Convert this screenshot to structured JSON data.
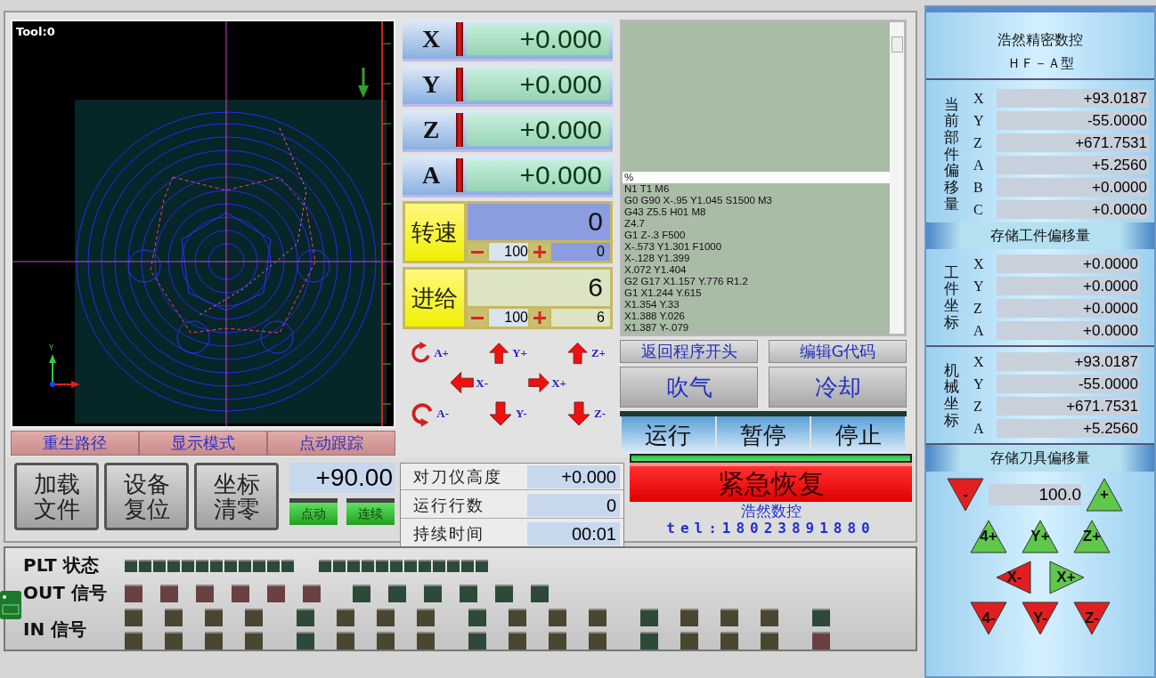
{
  "viewport": {
    "tool_label": "Tool:0",
    "axis_label": "Y"
  },
  "view_buttons": [
    "重生路径",
    "显示模式",
    "点动跟踪"
  ],
  "dro": [
    {
      "axis": "X",
      "value": "+0.000"
    },
    {
      "axis": "Y",
      "value": "+0.000"
    },
    {
      "axis": "Z",
      "value": "+0.000"
    },
    {
      "axis": "A",
      "value": "+0.000"
    }
  ],
  "rates": [
    {
      "label": "转速",
      "value": "0",
      "override": "100",
      "actual": "0",
      "kind": "spindle"
    },
    {
      "label": "进给",
      "value": "6",
      "override": "100",
      "actual": "6",
      "kind": "feed"
    }
  ],
  "jog_pad": [
    {
      "label": "A+",
      "kind": "clockwise"
    },
    {
      "label": "Y+",
      "kind": "up"
    },
    {
      "label": "Z+",
      "kind": "up"
    },
    {
      "label": "X-",
      "kind": "left"
    },
    {
      "label": "X+",
      "kind": "right"
    },
    {
      "label": "A-",
      "kind": "anticlockwise"
    },
    {
      "label": "Y-",
      "kind": "down"
    },
    {
      "label": "Z-",
      "kind": "down"
    }
  ],
  "gcode": {
    "lines": [
      {
        "text": "%",
        "selected": true
      },
      {
        "text": "N1 T1 M6",
        "selected": false
      },
      {
        "text": "G0 G90 X-.95 Y1.045 S1500 M3",
        "selected": false
      },
      {
        "text": "G43 Z5.5 H01 M8",
        "selected": false
      },
      {
        "text": "Z4.7",
        "selected": false
      },
      {
        "text": "G1 Z-.3 F500",
        "selected": false
      },
      {
        "text": "X-.573 Y1.301 F1000",
        "selected": false
      },
      {
        "text": "X-.128 Y1.399",
        "selected": false
      },
      {
        "text": "X.072 Y1.404",
        "selected": false
      },
      {
        "text": "G2 G17 X1.157 Y.776 R1.2",
        "selected": false
      },
      {
        "text": "G1 X1.244 Y.615",
        "selected": false
      },
      {
        "text": "X1.354 Y.33",
        "selected": false
      },
      {
        "text": "X1.388 Y.026",
        "selected": false
      },
      {
        "text": "X1.387 Y-.079",
        "selected": false
      }
    ]
  },
  "program_buttons": [
    "返回程序开头",
    "编辑G代码"
  ],
  "aux_buttons": [
    "吹气",
    "冷却"
  ],
  "run_buttons": [
    "运行",
    "暂停",
    "停止"
  ],
  "file_buttons": [
    "加载文件",
    "设备复位",
    "坐标清零"
  ],
  "jog_step": {
    "value": "+90.00",
    "modes": [
      "点动",
      "连续"
    ]
  },
  "info": [
    {
      "label": "对刀仪高度",
      "value": "+0.000"
    },
    {
      "label": "运行行数",
      "value": "0"
    },
    {
      "label": "持续时间",
      "value": "00:01"
    }
  ],
  "emergency": {
    "label": "紧急恢复",
    "brand": "浩然数控",
    "tel": "tel:18023891880"
  },
  "signals": [
    {
      "label": "PLT 状态",
      "kind": "status",
      "rows": [
        [
          [
            {
              "color": "#2d4a38"
            },
            {
              "color": "#2d4a38"
            },
            {
              "color": "#2d4a38"
            },
            {
              "color": "#2d4a38"
            },
            {
              "color": "#2d4a38"
            },
            {
              "color": "#2d4a38"
            },
            {
              "color": "#2d4a38"
            },
            {
              "color": "#2d4a38"
            },
            {
              "color": "#2d4a38"
            },
            {
              "color": "#2d4a38"
            },
            {
              "color": "#2d4a38"
            },
            {
              "color": "#2d4a38"
            }
          ],
          [
            {
              "color": "#2d4a38"
            },
            {
              "color": "#2d4a38"
            },
            {
              "color": "#2d4a38"
            },
            {
              "color": "#2d4a38"
            },
            {
              "color": "#2d4a38"
            },
            {
              "color": "#2d4a38"
            },
            {
              "color": "#2d4a38"
            },
            {
              "color": "#2d4a38"
            },
            {
              "color": "#2d4a38"
            },
            {
              "color": "#2d4a38"
            },
            {
              "color": "#2d4a38"
            },
            {
              "color": "#2d4a38"
            }
          ]
        ]
      ]
    },
    {
      "label": "OUT 信号",
      "kind": "output",
      "rows": [
        [
          [
            {
              "color": "#6a4040"
            },
            {
              "color": "#6a4040"
            },
            {
              "color": "#6a4040"
            },
            {
              "color": "#6a4040"
            },
            {
              "color": "#6a4040"
            },
            {
              "color": "#6a4040"
            }
          ],
          [
            {
              "color": "#2d4a38"
            },
            {
              "color": "#2d4a38"
            },
            {
              "color": "#2d4a38"
            },
            {
              "color": "#2d4a38"
            },
            {
              "color": "#2d4a38"
            },
            {
              "color": "#2d4a38"
            }
          ]
        ]
      ]
    },
    {
      "label": "IN 信号",
      "kind": "input",
      "rows": [
        [
          [
            {
              "color": "#4a4630"
            },
            {
              "color": "#4a4630"
            },
            {
              "color": "#4a4630"
            },
            {
              "color": "#4a4630"
            }
          ],
          [
            {
              "color": "#2d4a38"
            },
            {
              "color": "#4a4630"
            },
            {
              "color": "#4a4630"
            },
            {
              "color": "#4a4630"
            }
          ],
          [
            {
              "color": "#2d4a38"
            },
            {
              "color": "#4a4630"
            },
            {
              "color": "#4a4630"
            },
            {
              "color": "#4a4630"
            }
          ],
          [
            {
              "color": "#2d4a38"
            },
            {
              "color": "#4a4630"
            },
            {
              "color": "#4a4630"
            },
            {
              "color": "#4a4630"
            }
          ],
          [
            {
              "color": "#2d4a38"
            }
          ]
        ],
        [
          [
            {
              "color": "#4a4630"
            },
            {
              "color": "#4a4630"
            },
            {
              "color": "#4a4630"
            },
            {
              "color": "#4a4630"
            }
          ],
          [
            {
              "color": "#2d4a38"
            },
            {
              "color": "#4a4630"
            },
            {
              "color": "#4a4630"
            },
            {
              "color": "#4a4630"
            }
          ],
          [
            {
              "color": "#2d4a38"
            },
            {
              "color": "#4a4630"
            },
            {
              "color": "#4a4630"
            },
            {
              "color": "#4a4630"
            }
          ],
          [
            {
              "color": "#2d4a38"
            },
            {
              "color": "#4a4630"
            },
            {
              "color": "#4a4630"
            },
            {
              "color": "#4a4630"
            }
          ],
          [
            {
              "color": "#6a4040"
            }
          ]
        ]
      ]
    }
  ],
  "side": {
    "title": "浩然精密数控",
    "model": "ＨＦ－Ａ型",
    "part_offset": {
      "label": "当前部件偏移量",
      "rows": [
        {
          "axis": "X",
          "value": "+93.0187"
        },
        {
          "axis": "Y",
          "value": "-55.0000"
        },
        {
          "axis": "Z",
          "value": "+671.7531"
        },
        {
          "axis": "A",
          "value": "+5.2560"
        },
        {
          "axis": "B",
          "value": "+0.0000"
        },
        {
          "axis": "C",
          "value": "+0.0000"
        }
      ]
    },
    "work_offset_button": "存储工件偏移量",
    "coord_groups": [
      {
        "label": "工件坐标",
        "rows": [
          {
            "axis": "X",
            "value": "+0.0000"
          },
          {
            "axis": "Y",
            "value": "+0.0000"
          },
          {
            "axis": "Z",
            "value": "+0.0000"
          },
          {
            "axis": "A",
            "value": "+0.0000"
          }
        ]
      },
      {
        "label": "机械坐标",
        "rows": [
          {
            "axis": "X",
            "value": "+93.0187"
          },
          {
            "axis": "Y",
            "value": "-55.0000"
          },
          {
            "axis": "Z",
            "value": "+671.7531"
          },
          {
            "axis": "A",
            "value": "+5.2560"
          }
        ]
      }
    ],
    "tool_offset_button": "存储刀具偏移量",
    "step": {
      "minus": {
        "label": "-",
        "kind": "down"
      },
      "value": "100.0",
      "plus": {
        "label": "+",
        "kind": "up"
      }
    },
    "tool_jog": [
      [
        {
          "label": "4+",
          "kind": "up"
        },
        {
          "label": "Y+",
          "kind": "up"
        },
        {
          "label": "Z+",
          "kind": "up"
        }
      ],
      [
        {
          "label": "X-",
          "kind": "left"
        },
        {
          "label": "X+",
          "kind": "right"
        }
      ],
      [
        {
          "label": "4-",
          "kind": "down"
        },
        {
          "label": "Y-",
          "kind": "down"
        },
        {
          "label": "Z-",
          "kind": "down"
        }
      ]
    ]
  }
}
